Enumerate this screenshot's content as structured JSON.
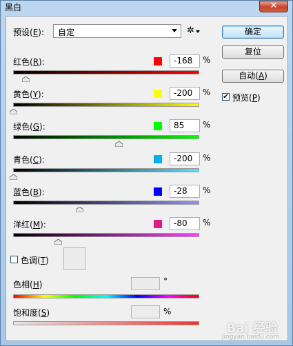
{
  "window": {
    "title": "黑白"
  },
  "preset": {
    "label": "预设",
    "key": "E",
    "value": "自定"
  },
  "buttons": {
    "ok": "确定",
    "reset": "复位",
    "auto_text": "自动",
    "auto_key": "A"
  },
  "preview": {
    "label": "预览",
    "key": "P",
    "checked": true
  },
  "sliders": [
    {
      "label": "红色",
      "key": "R",
      "value": "-168",
      "color": "#ff0000",
      "track_from": "#000000",
      "track_to": "#ff0000",
      "fraction": 0.066
    },
    {
      "label": "黄色",
      "key": "Y",
      "value": "-200",
      "color": "#ffff00",
      "track_from": "#000000",
      "track_to": "#ffff00",
      "fraction": 0.0
    },
    {
      "label": "绿色",
      "key": "G",
      "value": "85",
      "color": "#00ff00",
      "track_from": "#000000",
      "track_to": "#00ff00",
      "fraction": 0.566
    },
    {
      "label": "青色",
      "key": "C",
      "value": "-200",
      "color": "#00b0f0",
      "track_from": "#000000",
      "track_to": "#55e0ff",
      "fraction": 0.0
    },
    {
      "label": "蓝色",
      "key": "B",
      "value": "-28",
      "color": "#0000ff",
      "track_from": "#000000",
      "track_to": "#9090ff",
      "fraction": 0.357
    },
    {
      "label": "洋红",
      "key": "M",
      "value": "-80",
      "color": "#e0188a",
      "track_from": "#000000",
      "track_to": "#ff40ff",
      "fraction": 0.241
    }
  ],
  "percent_sign": "%",
  "tint": {
    "label": "色调",
    "key": "T",
    "checked": false
  },
  "hue": {
    "label": "色相",
    "key": "H",
    "unit": "°"
  },
  "saturation": {
    "label": "饱和度",
    "key": "S",
    "unit": "%"
  },
  "watermark": {
    "text": "Bai 经验",
    "sub": "jingyan.baidu.com"
  }
}
